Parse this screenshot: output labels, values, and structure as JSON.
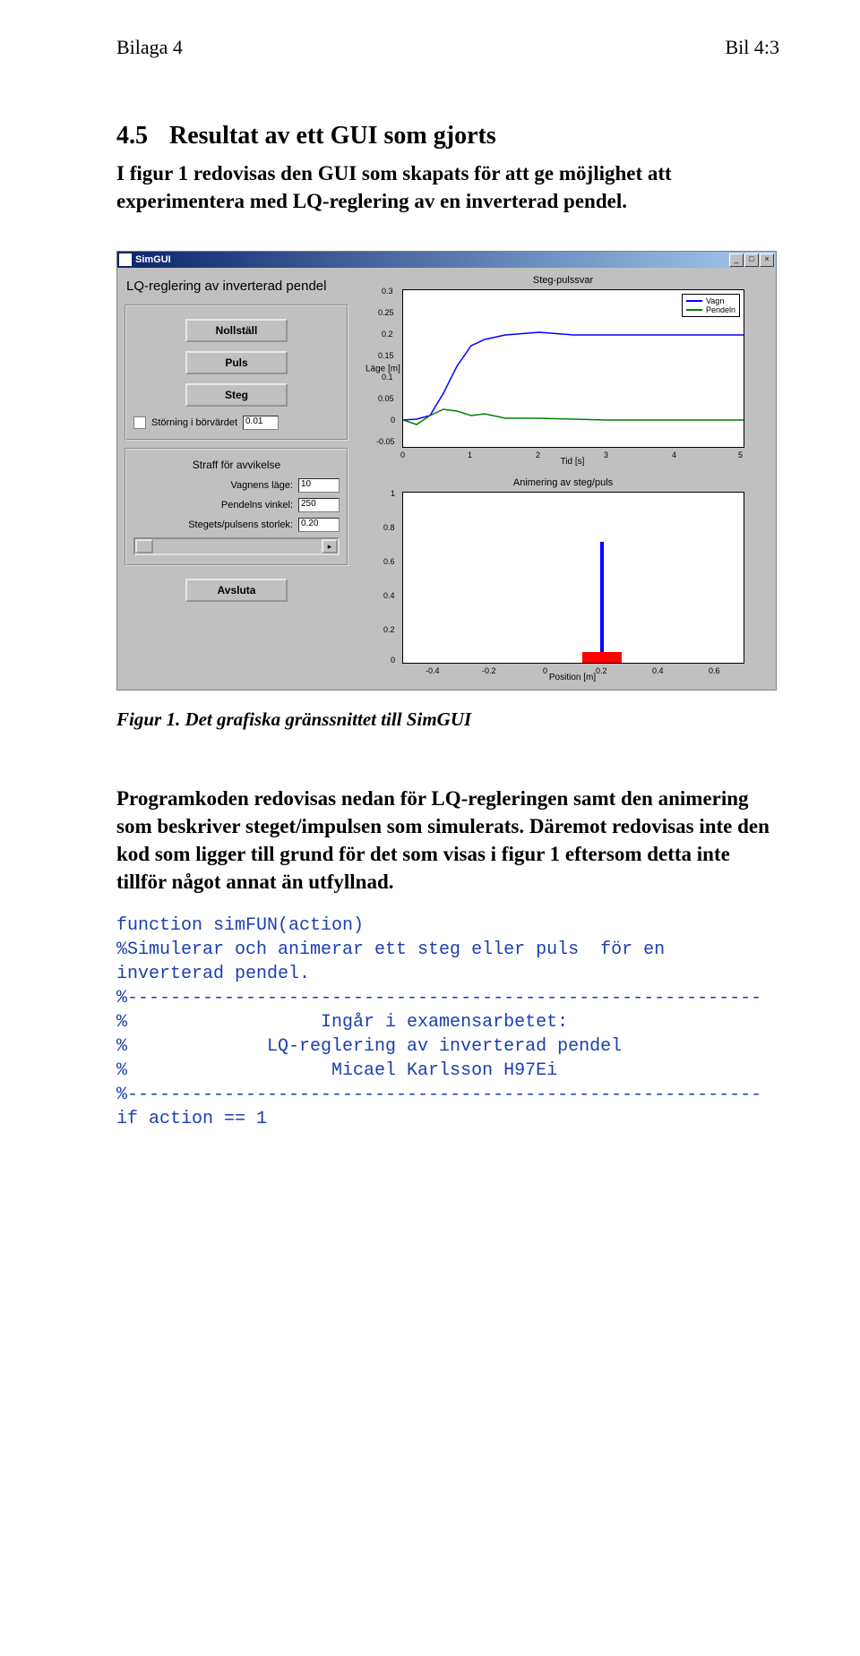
{
  "header": {
    "left": "Bilaga 4",
    "right": "Bil 4:3"
  },
  "section": {
    "num": "4.5",
    "title": "Resultat av ett GUI som gjorts",
    "intro": "I figur 1 redovisas den GUI som skapats för att ge möjlighet att experimentera med LQ-reglering av en inverterad pendel."
  },
  "gui": {
    "window_title": "SimGUI",
    "main_title": "LQ-reglering av inverterad pendel",
    "buttons": {
      "nollstall": "Nollställ",
      "puls": "Puls",
      "steg": "Steg",
      "avsluta": "Avsluta"
    },
    "disturb": {
      "label": "Störning i börvärdet",
      "value": "0.01"
    },
    "penalty_title": "Straff för avvikelse",
    "params": {
      "vagn_label": "Vagnens läge:",
      "vagn_value": "10",
      "pendel_label": "Pendelns vinkel:",
      "pendel_value": "250",
      "steg_label": "Stegets/pulsens storlek:",
      "steg_value": "0.20"
    },
    "plot1": {
      "title": "Steg-pulssvar",
      "ylabel": "Läge [m]",
      "xlabel": "Tid [s]",
      "legend": {
        "a": "Vagn",
        "b": "Pendeln"
      },
      "yticks": [
        "0.3",
        "0.25",
        "0.2",
        "0.15",
        "0.1",
        "0.05",
        "0",
        "-0.05"
      ],
      "xticks": [
        "0",
        "1",
        "2",
        "3",
        "4",
        "5"
      ]
    },
    "plot2": {
      "title": "Animering av steg/puls",
      "xlabel": "Position [m]",
      "yticks": [
        "1",
        "0.8",
        "0.6",
        "0.4",
        "0.2",
        "0"
      ],
      "xticks": [
        "-0.4",
        "-0.2",
        "0",
        "0.2",
        "0.4",
        "0.6"
      ]
    }
  },
  "fig_caption": "Figur 1. Det grafiska gränssnittet till SimGUI",
  "body_para": "Programkoden redovisas nedan för LQ-regleringen samt den animering som beskriver steget/impulsen som simulerats. Däremot redovisas inte den kod som ligger till grund för det som visas i figur 1 eftersom detta inte tillför något annat än utfyllnad.",
  "code": "function simFUN(action)\n%Simulerar och animerar ett steg eller puls  för en\ninverterad pendel.\n%-----------------------------------------------------------\n%                  Ingår i examensarbetet:\n%             LQ-reglering av inverterad pendel\n%                   Micael Karlsson H97Ei\n%-----------------------------------------------------------\nif action == 1",
  "chart_data": [
    {
      "type": "line",
      "title": "Steg-pulssvar",
      "xlabel": "Tid [s]",
      "ylabel": "Läge [m]",
      "xlim": [
        0,
        5
      ],
      "ylim": [
        -0.05,
        0.3
      ],
      "legend_position": "top-right",
      "series": [
        {
          "name": "Vagn",
          "color": "#0000ff",
          "x": [
            0,
            0.2,
            0.4,
            0.6,
            0.8,
            1.0,
            1.2,
            1.5,
            2.0,
            2.5,
            3.0,
            4.0,
            5.0
          ],
          "y": [
            0,
            0.005,
            0.02,
            0.07,
            0.13,
            0.17,
            0.19,
            0.205,
            0.21,
            0.2,
            0.2,
            0.2,
            0.2
          ]
        },
        {
          "name": "Pendeln",
          "color": "#008000",
          "x": [
            0,
            0.2,
            0.4,
            0.6,
            0.8,
            1.0,
            1.2,
            1.5,
            2.0,
            3.0,
            5.0
          ],
          "y": [
            0,
            -0.01,
            0.01,
            0.025,
            0.02,
            0.01,
            0.015,
            0.005,
            0.005,
            0.0,
            0.0
          ]
        }
      ]
    },
    {
      "type": "line",
      "title": "Animering av steg/puls",
      "xlabel": "Position [m]",
      "ylabel": "",
      "xlim": [
        -0.5,
        0.7
      ],
      "ylim": [
        0,
        1
      ],
      "annotations": [
        {
          "shape": "rect",
          "x": 0.14,
          "y": 0.0,
          "w": 0.14,
          "h": 0.05,
          "color": "#ff0000",
          "note": "cart"
        },
        {
          "shape": "line",
          "x0": 0.2,
          "y0": 0.05,
          "x1": 0.2,
          "y1": 0.72,
          "color": "#0000ff",
          "note": "pendulum"
        }
      ],
      "series": []
    }
  ]
}
